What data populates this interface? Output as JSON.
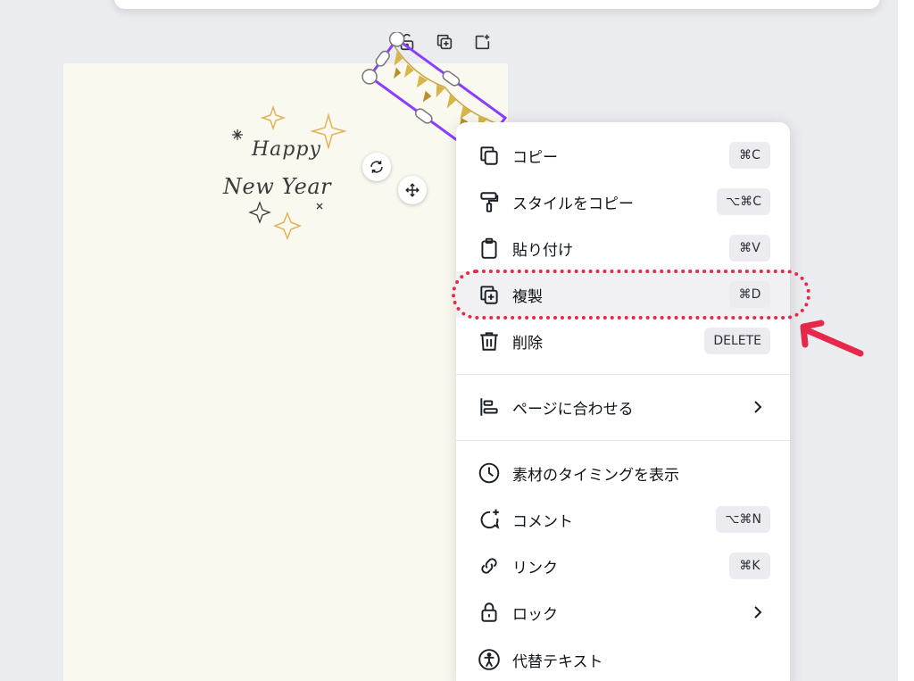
{
  "menu": {
    "items": [
      {
        "icon": "copy-icon",
        "label": "コピー",
        "shortcut": "⌘C"
      },
      {
        "icon": "paint-roller-icon",
        "label": "スタイルをコピー",
        "shortcut": "⌥⌘C"
      },
      {
        "icon": "clipboard-icon",
        "label": "貼り付け",
        "shortcut": "⌘V"
      },
      {
        "icon": "duplicate-icon",
        "label": "複製",
        "shortcut": "⌘D"
      },
      {
        "icon": "trash-icon",
        "label": "削除",
        "shortcut": "DELETE"
      },
      {
        "icon": "align-icon",
        "label": "ページに合わせる",
        "shortcut": ""
      },
      {
        "icon": "clock-icon",
        "label": "素材のタイミングを表示",
        "shortcut": ""
      },
      {
        "icon": "comment-icon",
        "label": "コメント",
        "shortcut": "⌥⌘N"
      },
      {
        "icon": "link-icon",
        "label": "リンク",
        "shortcut": "⌘K"
      },
      {
        "icon": "lock-icon",
        "label": "ロック",
        "shortcut": ""
      },
      {
        "icon": "accessibility-icon",
        "label": "代替テキスト",
        "shortcut": ""
      }
    ]
  },
  "card": {
    "line1": "Happy",
    "line2": "New Year"
  },
  "colors": {
    "accent_selection": "#8b3dff",
    "annotation_red": "#e6284a",
    "sparkle_gold": "#e0b35a"
  }
}
